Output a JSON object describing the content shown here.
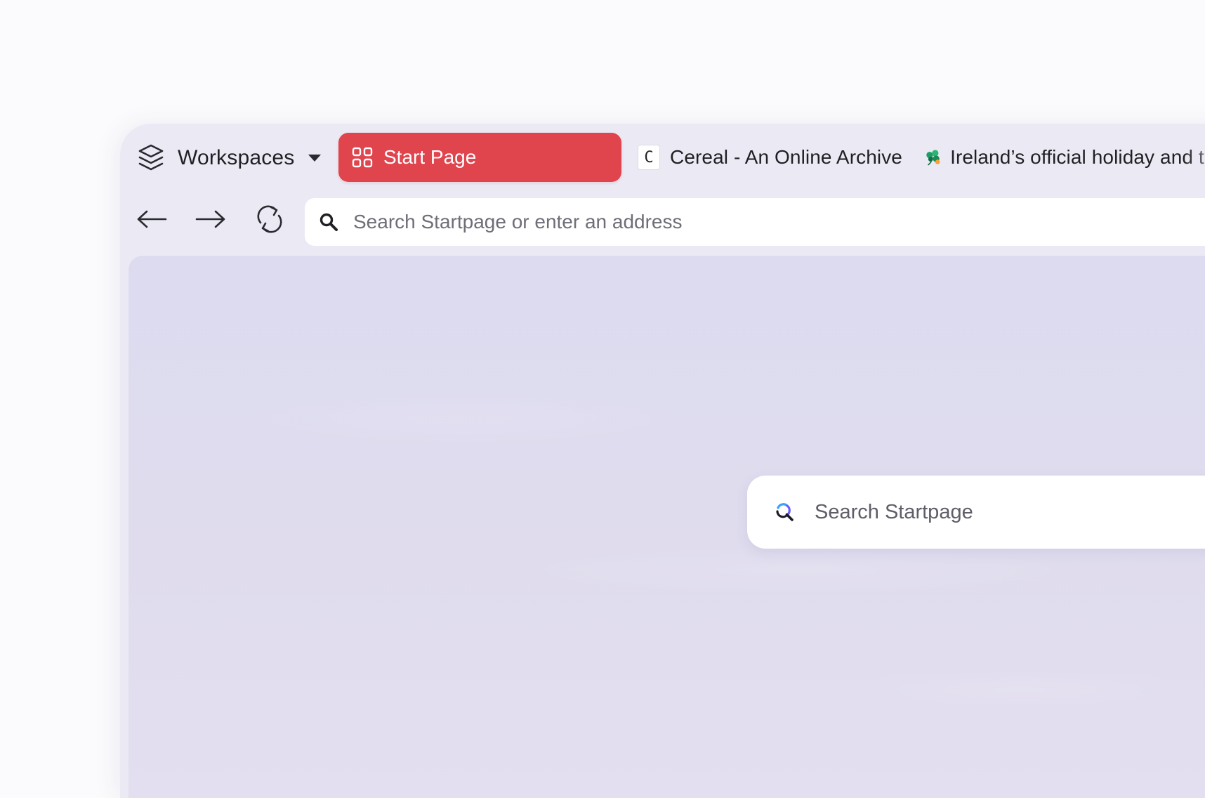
{
  "browser": {
    "workspaces": {
      "label": "Workspaces",
      "icon": "layers-icon",
      "dropdown_icon": "caret-down-icon"
    },
    "tabs": [
      {
        "label": "Start Page",
        "icon": "grid-icon",
        "active": true,
        "color": "#e0444d"
      },
      {
        "label": "Cereal - An Online Archive",
        "icon": "cereal-favicon",
        "favicon_text": "C",
        "active": false
      },
      {
        "label": "Ireland’s official holiday and travel",
        "icon": "shamrock-icon",
        "active": false
      }
    ],
    "toolbar": {
      "back_icon": "arrow-left-icon",
      "forward_icon": "arrow-right-icon",
      "reload_icon": "reload-icon",
      "address_placeholder": "Search Startpage or enter an address",
      "address_icon": "search-icon"
    }
  },
  "page": {
    "search_placeholder": "Search Startpage",
    "search_icon": "startpage-search-icon"
  }
}
